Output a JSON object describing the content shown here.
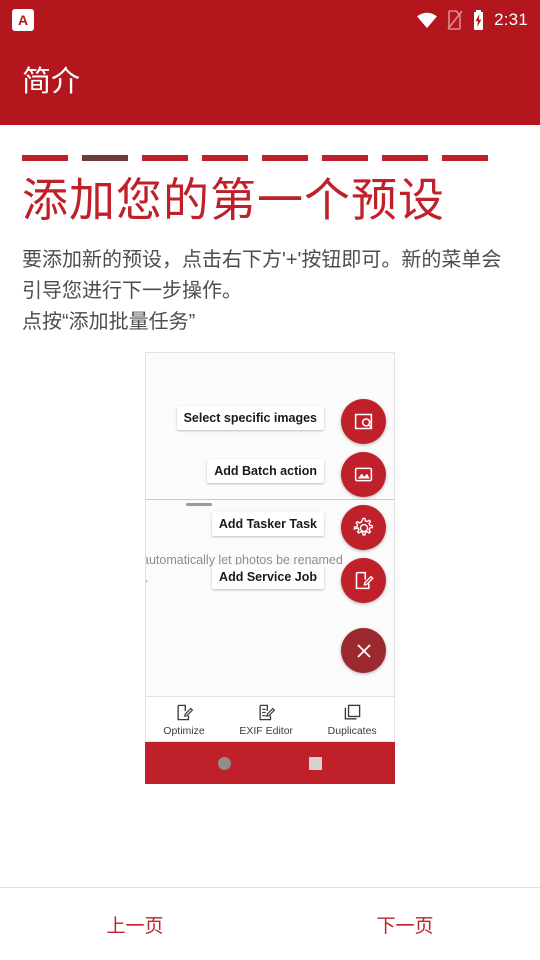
{
  "status_bar": {
    "app_icon": "app-letter-a-icon",
    "wifi_icon": "wifi-icon",
    "sim_icon": "no-sim-icon",
    "battery_icon": "battery-charging-icon",
    "clock": "2:31"
  },
  "app_bar": {
    "title": "简介"
  },
  "intro": {
    "headline": "添加您的第一个预设",
    "body": "要添加新的预设，点击右下方'+'按钮即可。新的菜单会引导您进行下一步操作。\n点按“添加批量任务”",
    "dashes": [
      "dash-1",
      "dash-2",
      "dash-3",
      "dash-4",
      "dash-5",
      "dash-6",
      "dash-7",
      "dash-8"
    ]
  },
  "illustration": {
    "menu_items": [
      {
        "label": "Select specific images",
        "icon": "image-search-icon"
      },
      {
        "label": "Add Batch action",
        "icon": "photo-library-icon"
      },
      {
        "label": "Add Tasker Task",
        "icon": "gear-icon"
      },
      {
        "label": "Add Service Job",
        "icon": "edit-document-icon"
      }
    ],
    "close_icon": "close-icon",
    "faded_text": "automatically let photos be renamed\nl.",
    "bottom_nav": [
      {
        "label": "Optimize",
        "icon": "optimize-icon"
      },
      {
        "label": "EXIF Editor",
        "icon": "exif-editor-icon"
      },
      {
        "label": "Duplicates",
        "icon": "duplicates-icon"
      }
    ],
    "system_nav": [
      {
        "icon": "home-circle-icon"
      },
      {
        "icon": "recents-square-icon"
      }
    ]
  },
  "footer": {
    "prev_label": "上一页",
    "next_label": "下一页"
  },
  "colors": {
    "brand_red": "#b3161d",
    "accent_red": "#c0202a",
    "text_gray": "#4d4d4d"
  }
}
